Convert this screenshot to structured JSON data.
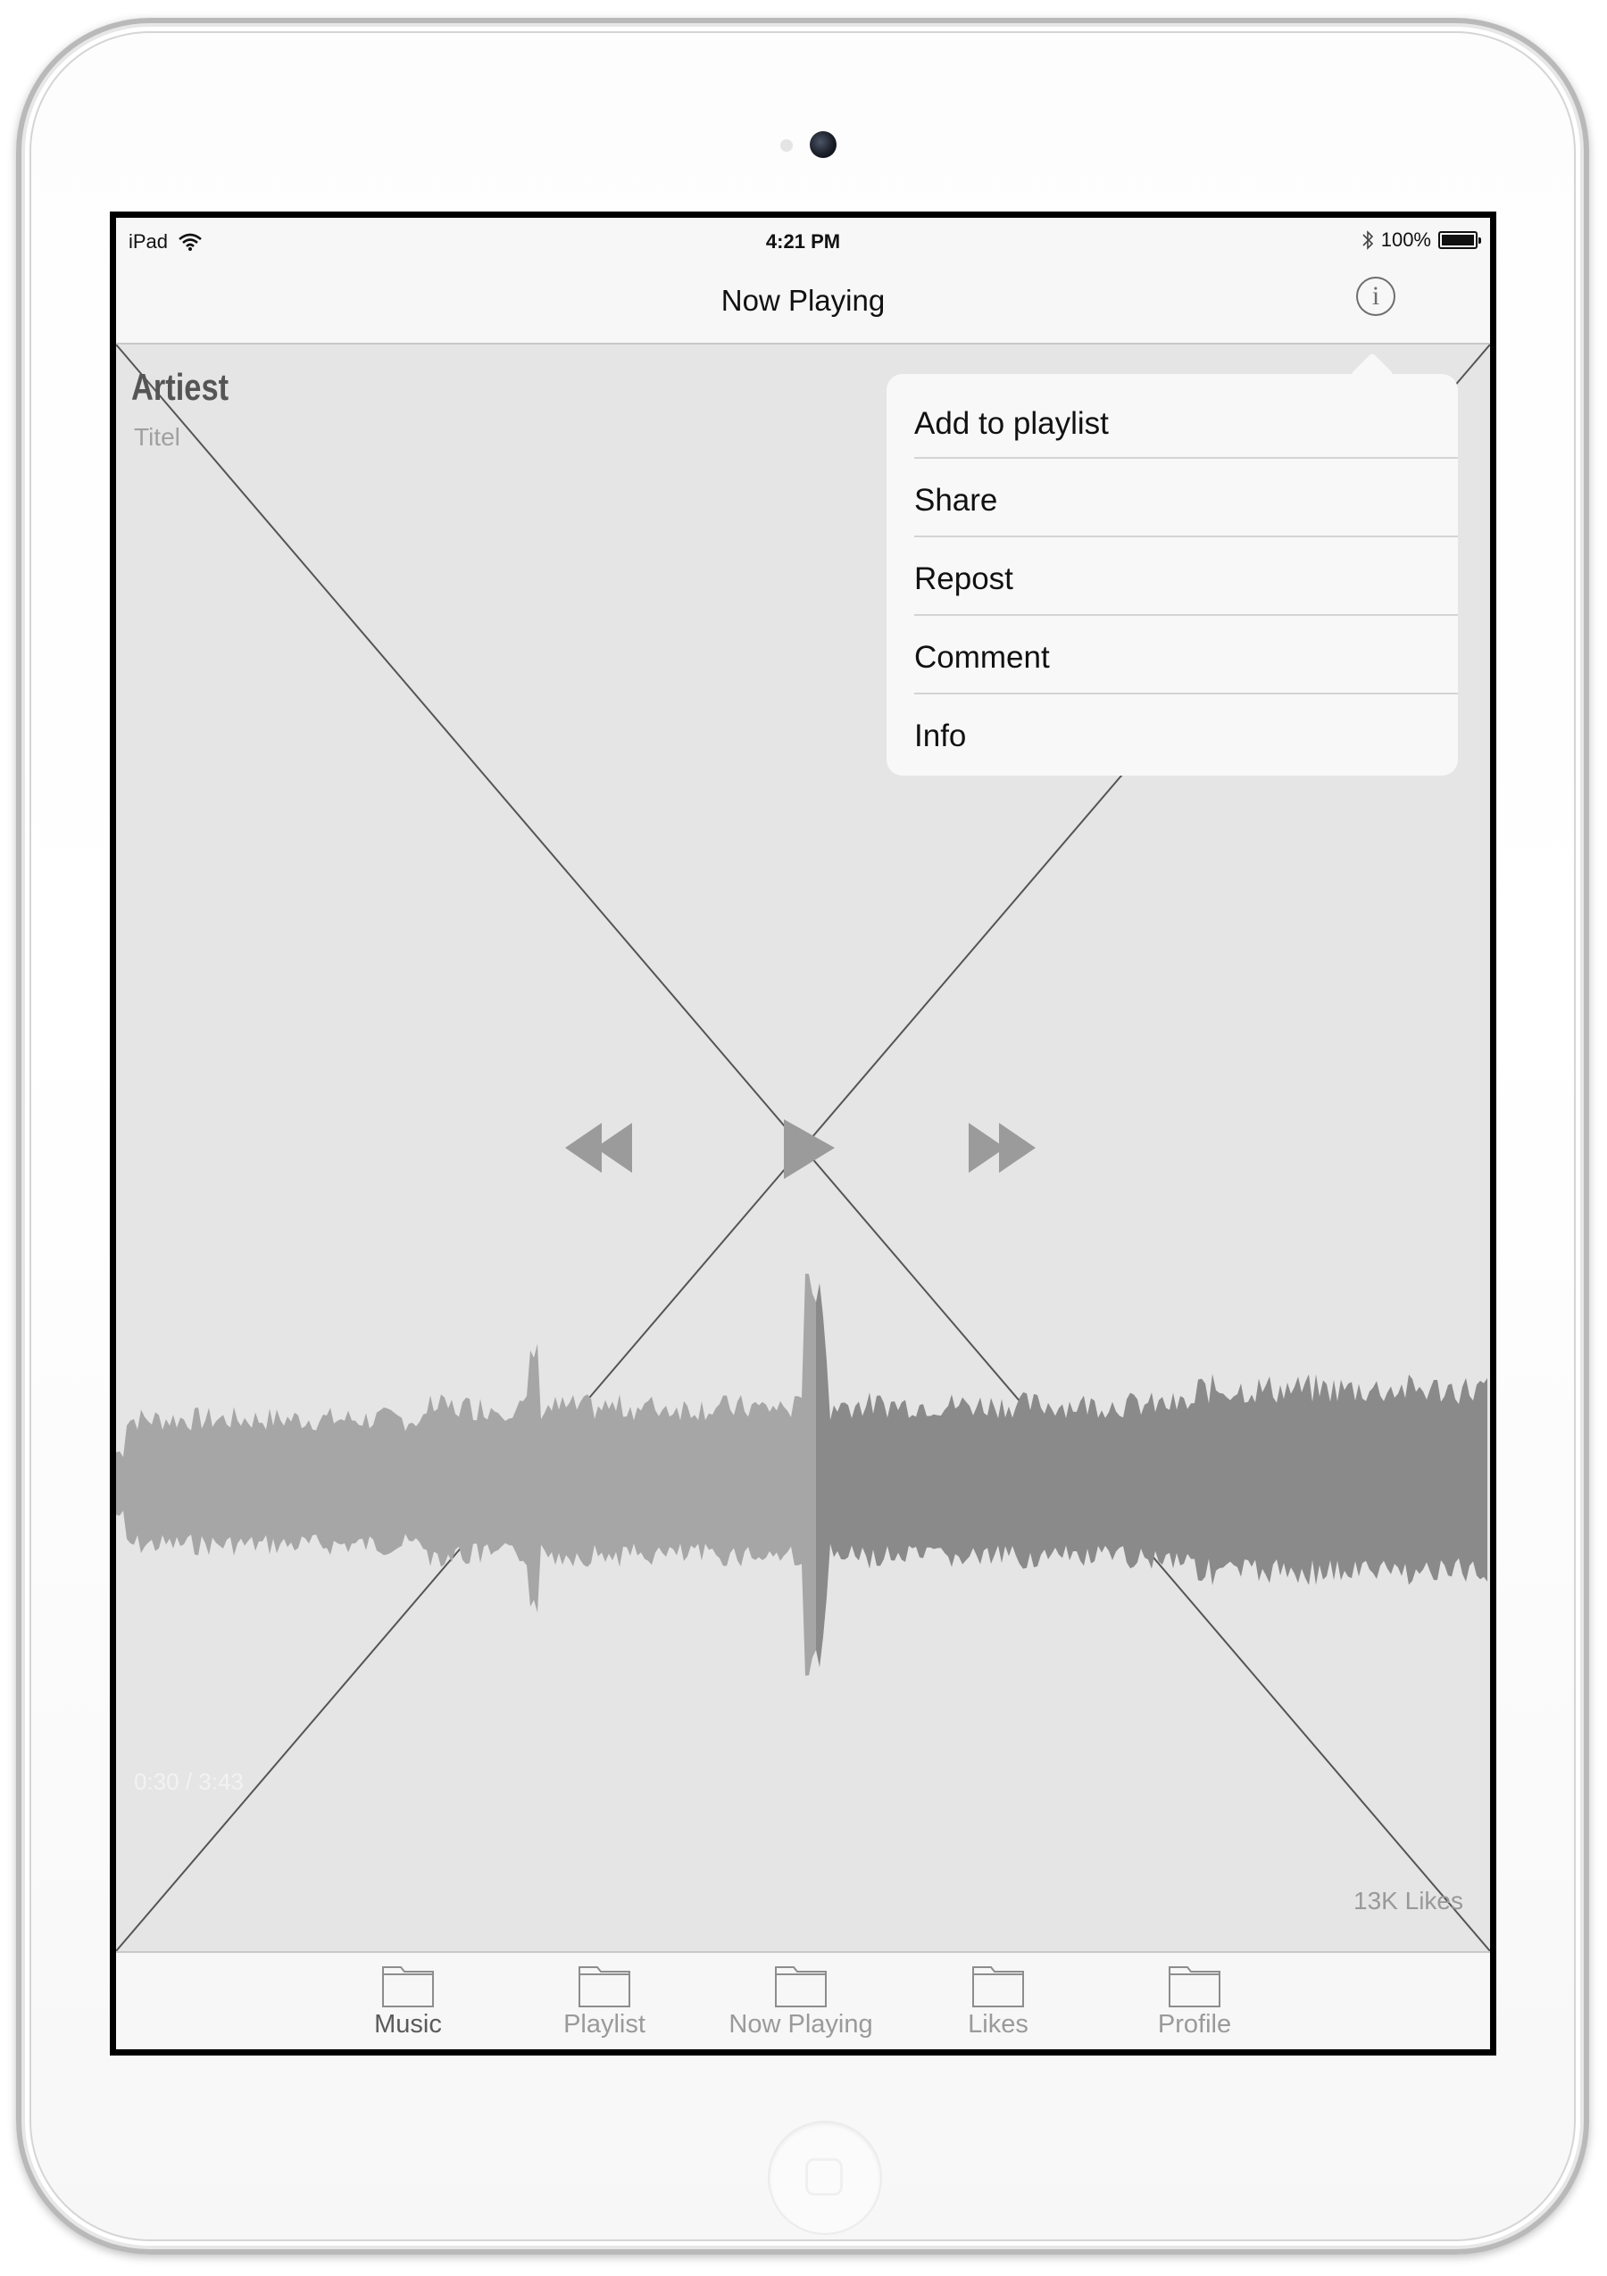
{
  "status_bar": {
    "device": "iPad",
    "time": "4:21 PM",
    "battery": "100%"
  },
  "nav": {
    "title": "Now Playing",
    "info_glyph": "i"
  },
  "track": {
    "artist": "Artiest",
    "title": "Titel",
    "time": "0:30 / 3:43",
    "likes": "13K Likes",
    "progress": 0.51
  },
  "popover": {
    "items": [
      {
        "label": "Add to playlist"
      },
      {
        "label": "Share"
      },
      {
        "label": "Repost"
      },
      {
        "label": "Comment"
      },
      {
        "label": "Info"
      }
    ]
  },
  "tabs": [
    {
      "label": "Music",
      "active": true
    },
    {
      "label": "Playlist",
      "active": false
    },
    {
      "label": "Now Playing",
      "active": false
    },
    {
      "label": "Likes",
      "active": false
    },
    {
      "label": "Profile",
      "active": false
    }
  ],
  "icons": {
    "wifi": "wifi-icon",
    "bluetooth": "bluetooth-icon",
    "battery": "battery-icon",
    "info": "info-icon",
    "rewind": "rewind-icon",
    "play": "play-icon",
    "fast_forward": "fast-forward-icon",
    "tab_folder": "folder-icon"
  },
  "colors": {
    "waveform_played": "#a6a6a6",
    "waveform_unplayed": "#8a8a8a",
    "controls": "#9b9b9b",
    "bars": "#f7f7f7",
    "content_bg": "#e5e5e5"
  }
}
